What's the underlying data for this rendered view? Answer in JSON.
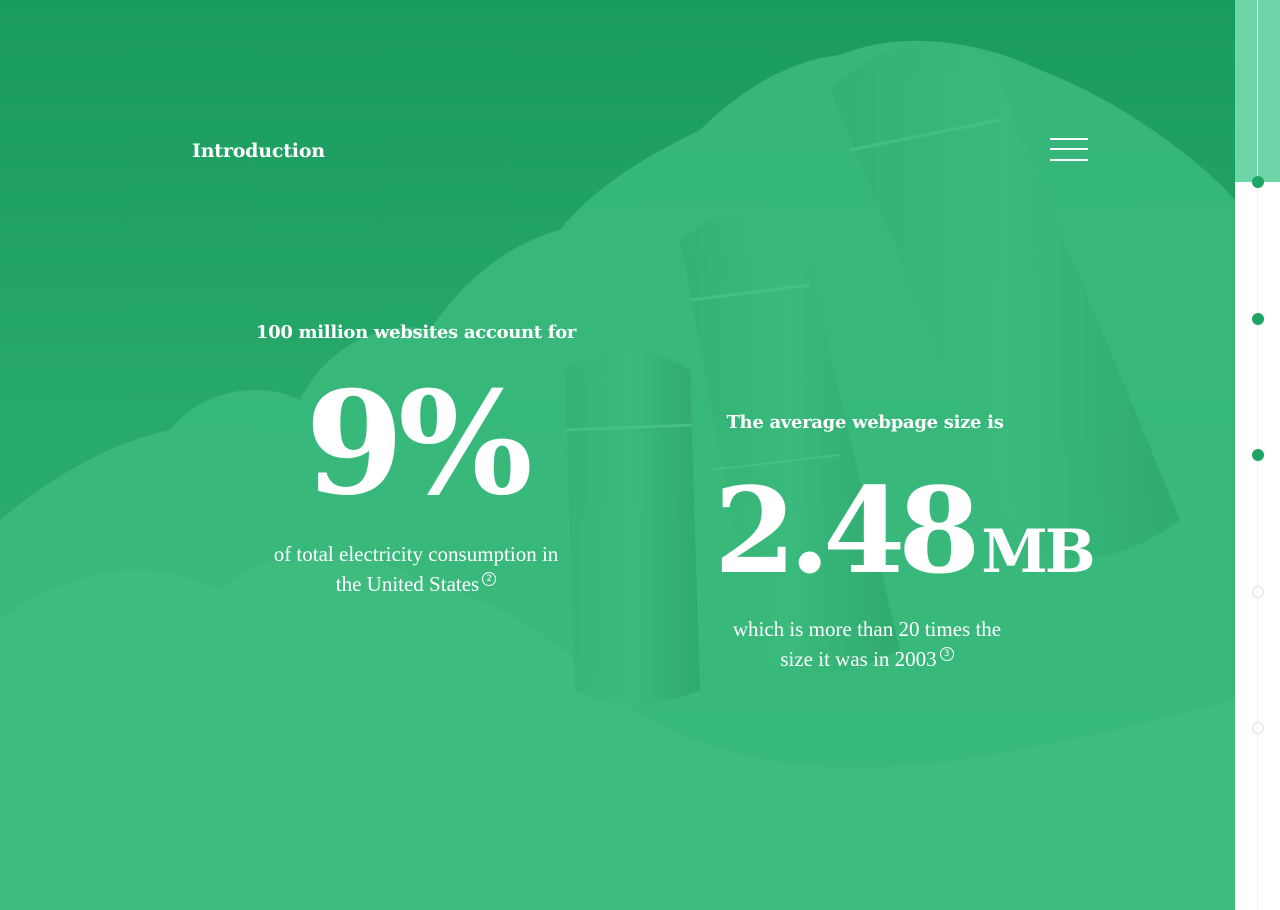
{
  "header": {
    "title": "Introduction",
    "menu_icon": "hamburger-menu-icon"
  },
  "stats": {
    "electricity": {
      "lead": "100 million websites account for",
      "value": "9",
      "percent": "%",
      "desc_line1": "of total electricity consumption in",
      "desc_line2": "the United States",
      "footnote": "2"
    },
    "webpage": {
      "lead": "The average webpage size is",
      "value": "2.48",
      "unit": "MB",
      "desc_line1": "which is more than 20 times the",
      "desc_line2": "size it was in 2003",
      "footnote": "3"
    }
  },
  "section_nav": {
    "progress": 0.2,
    "active_count": 3,
    "total": 5
  },
  "colors": {
    "overlay_green": "#2bb06f",
    "rail_progress": "#6dd5a8",
    "dot_active": "#1fa563",
    "text": "#ffffff"
  }
}
